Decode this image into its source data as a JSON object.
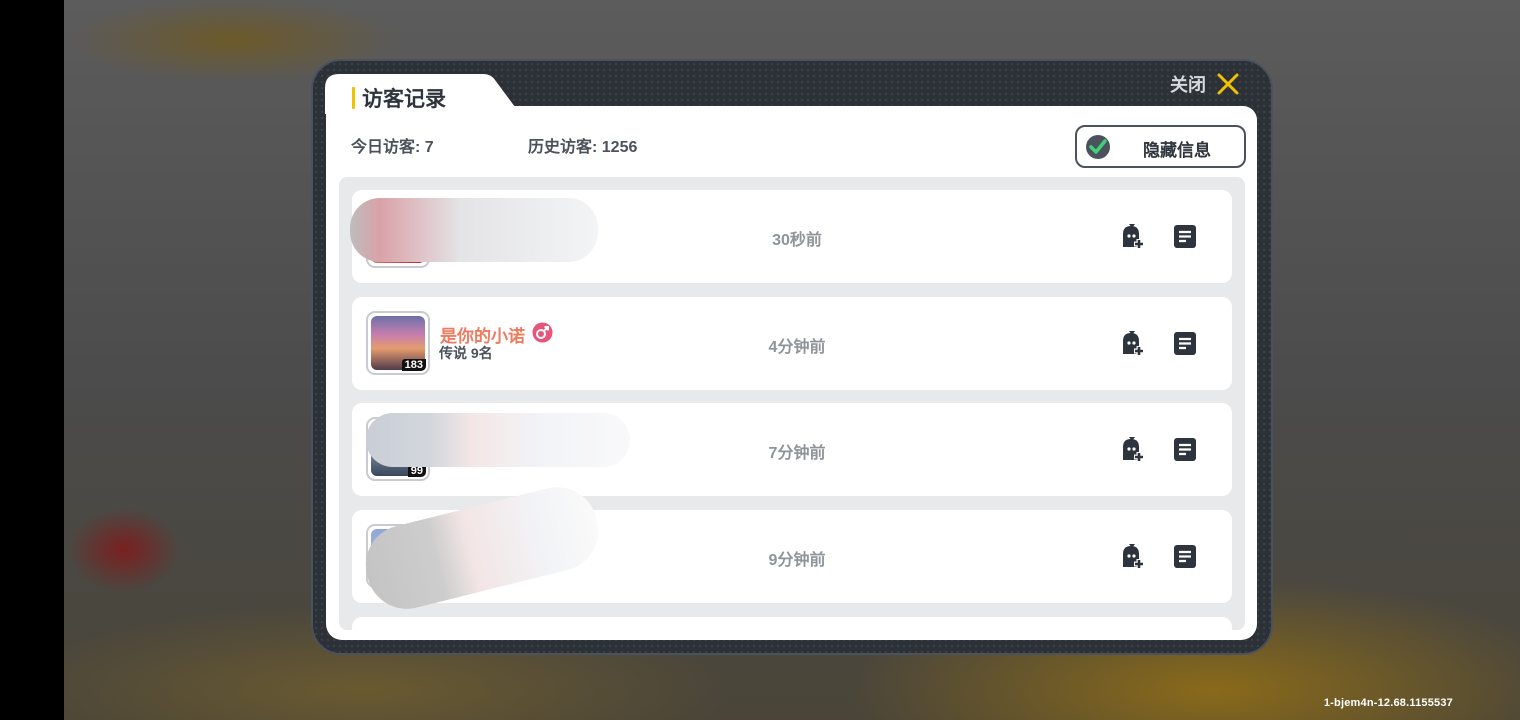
{
  "modal": {
    "title": "访客记录",
    "close_label": "关闭",
    "stats": {
      "today": "今日访客: 7",
      "history": "历史访客: 1256"
    },
    "hide_info": {
      "label": "隐藏信息",
      "checked": true
    }
  },
  "visitors": [
    {
      "name": "",
      "rank": "",
      "level": "",
      "time": "30秒前"
    },
    {
      "name": "是你的小诺",
      "rank": "传说 9名",
      "level": "183",
      "gender": "male",
      "time": "4分钟前"
    },
    {
      "name": "",
      "rank": "",
      "level": "99",
      "time": "7分钟前"
    },
    {
      "name": "",
      "rank": "",
      "level": "",
      "time": "9分钟前"
    }
  ],
  "build_tag": "1-bjem4n-12.68.1155537",
  "colors": {
    "accent": "#f2c200",
    "name": "#ef7b5f",
    "check": "#3fd27a",
    "icon_dark": "#2e343d"
  }
}
